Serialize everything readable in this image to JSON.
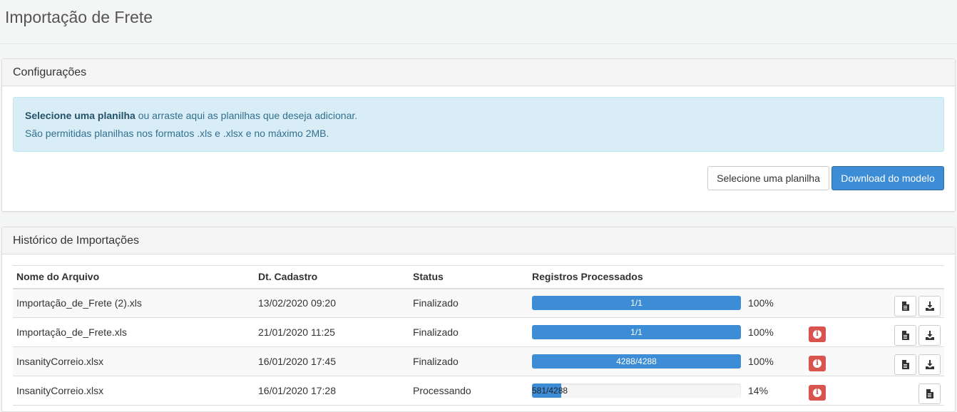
{
  "page": {
    "title": "Importação de Frete"
  },
  "config": {
    "heading": "Configurações",
    "alert_bold": "Selecione uma planilha",
    "alert_rest": " ou arraste aqui as planilhas que deseja adicionar.",
    "alert_line2": "São permitidas planilhas nos formatos .xls e .xlsx e no máximo 2MB.",
    "select_button": "Selecione uma planilha",
    "download_button": "Download do modelo"
  },
  "history": {
    "heading": "Histórico de Importações",
    "columns": [
      "Nome do Arquivo",
      "Dt. Cadastro",
      "Status",
      "Registros Processados"
    ],
    "rows": [
      {
        "file": "Importação_de_Frete (2).xls",
        "date": "13/02/2020 09:20",
        "status": "Finalizado",
        "progress_label": "1/1",
        "percent": "100%",
        "progress": 1.0
      },
      {
        "file": "Importação_de_Frete.xls",
        "date": "21/01/2020 11:25",
        "status": "Finalizado",
        "progress_label": "1/1",
        "percent": "100%",
        "progress": 1.0
      },
      {
        "file": "InsanityCorreio.xlsx",
        "date": "16/01/2020 17:45",
        "status": "Finalizado",
        "progress_label": "4288/4288",
        "percent": "100%",
        "progress": 1.0
      },
      {
        "file": "InsanityCorreio.xlsx",
        "date": "16/01/2020 17:28",
        "status": "Processando",
        "progress_label": "581/4288",
        "percent": "14%",
        "progress": 0.14
      }
    ]
  },
  "colors": {
    "primary": "#3c8dd6",
    "danger": "#d9534f",
    "info_bg": "#d9edf7",
    "info_text": "#31708f"
  }
}
